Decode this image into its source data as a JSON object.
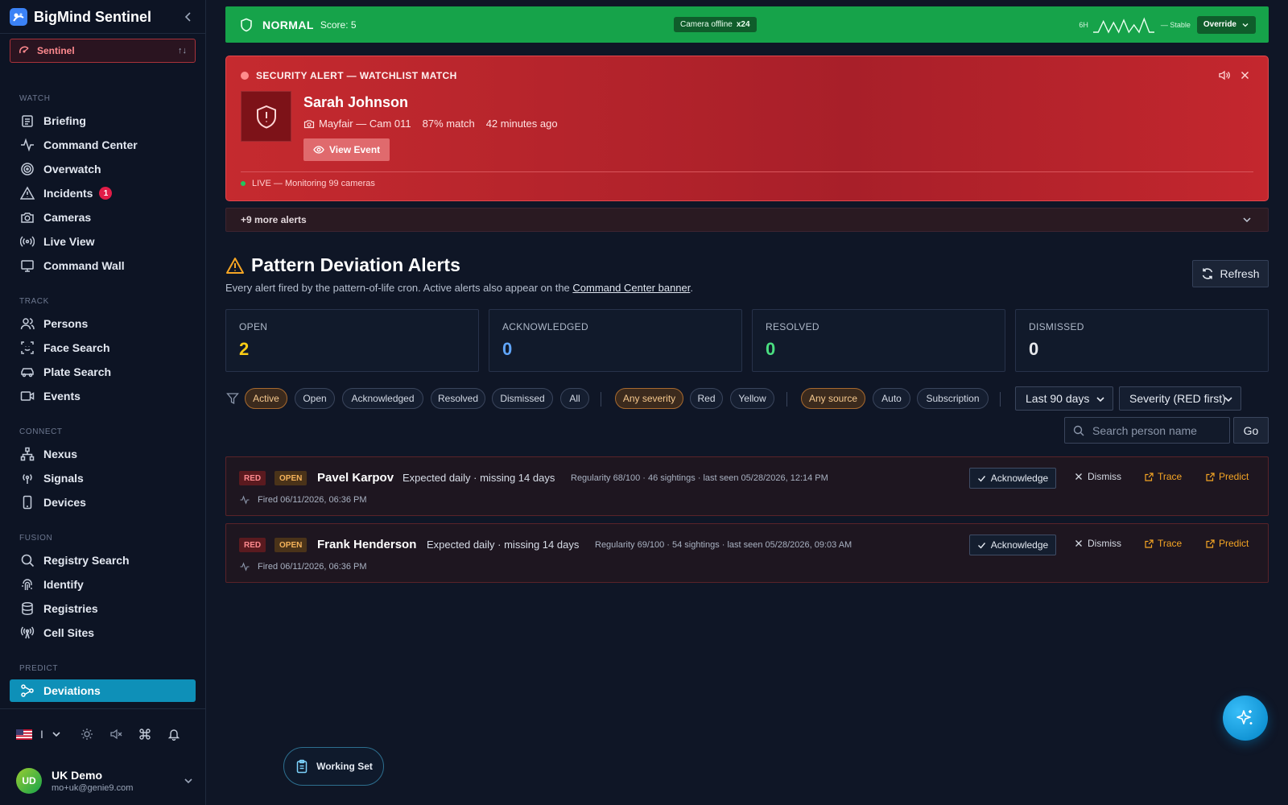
{
  "app": {
    "title": "BigMind Sentinel"
  },
  "workspace": {
    "label": "Sentinel"
  },
  "sidebar": {
    "sections": {
      "watch": "WATCH",
      "track": "TRACK",
      "connect": "CONNECT",
      "fusion": "FUSION",
      "predict": "PREDICT"
    },
    "items": {
      "briefing": "Briefing",
      "command_center": "Command Center",
      "overwatch": "Overwatch",
      "incidents": "Incidents",
      "incidents_badge": "1",
      "cameras": "Cameras",
      "live_view": "Live View",
      "command_wall": "Command Wall",
      "persons": "Persons",
      "face_search": "Face Search",
      "plate_search": "Plate Search",
      "events": "Events",
      "nexus": "Nexus",
      "signals": "Signals",
      "devices": "Devices",
      "registry_search": "Registry Search",
      "identify": "Identify",
      "registries": "Registries",
      "cell_sites": "Cell Sites",
      "deviations": "Deviations"
    },
    "tools": {
      "lang_sep": "I"
    },
    "user": {
      "initials": "UD",
      "name": "UK Demo",
      "email": "mo+uk@genie9.com"
    }
  },
  "status": {
    "level": "NORMAL",
    "score": "Score: 5",
    "camera_offline": "Camera offline",
    "camera_offline_count": "x24",
    "window": "6H",
    "trend": "— Stable",
    "override": "Override",
    "sparkline": [
      12,
      12,
      3,
      12,
      4,
      12,
      2,
      12,
      6,
      12,
      1,
      12,
      12
    ],
    "color": "#16a34a"
  },
  "security_alert": {
    "title": "SECURITY ALERT — WATCHLIST MATCH",
    "person": "Sarah Johnson",
    "location": "Mayfair — Cam 011",
    "match": "87% match",
    "time": "42 minutes ago",
    "view_button": "View Event",
    "live": "LIVE — Monitoring 99 cameras",
    "color": "#c52a2f"
  },
  "more_alerts": "+9 more alerts",
  "page": {
    "title": "Pattern Deviation Alerts",
    "subtitle": "Every alert fired by the pattern-of-life cron. Active alerts also appear on the",
    "subtitle_link": "Command Center banner",
    "subtitle_end": ".",
    "refresh": "Refresh"
  },
  "stats": [
    {
      "label": "OPEN",
      "value": "2",
      "color": "#facc15"
    },
    {
      "label": "ACKNOWLEDGED",
      "value": "0",
      "color": "#60a5fa"
    },
    {
      "label": "RESOLVED",
      "value": "0",
      "color": "#4ade80"
    },
    {
      "label": "DISMISSED",
      "value": "0",
      "color": "#e5e7eb"
    }
  ],
  "filters": {
    "status": [
      "Active",
      "Open",
      "Acknowledged",
      "Resolved",
      "Dismissed",
      "All"
    ],
    "status_selected": "Active",
    "severity": [
      "Any severity",
      "Red",
      "Yellow"
    ],
    "severity_selected": "Any severity",
    "source": [
      "Any source",
      "Auto",
      "Subscription"
    ],
    "source_selected": "Any source",
    "range": "Last 90 days",
    "sort": "Severity (RED first)",
    "search_placeholder": "Search person name",
    "go": "Go"
  },
  "alerts": [
    {
      "severity": "RED",
      "status": "OPEN",
      "name": "Pavel Karpov",
      "description": "Expected daily · missing 14 days",
      "meta": "Regularity 68/100 · 46 sightings · last seen 05/28/2026, 12:14 PM",
      "fired": "Fired 06/11/2026, 06:36 PM",
      "ack": "Acknowledge",
      "dismiss": "Dismiss",
      "trace": "Trace",
      "predict": "Predict"
    },
    {
      "severity": "RED",
      "status": "OPEN",
      "name": "Frank Henderson",
      "description": "Expected daily · missing 14 days",
      "meta": "Regularity 69/100 · 54 sightings · last seen 05/28/2026, 09:03 AM",
      "fired": "Fired 06/11/2026, 06:36 PM",
      "ack": "Acknowledge",
      "dismiss": "Dismiss",
      "trace": "Trace",
      "predict": "Predict"
    }
  ],
  "working_set": "Working Set"
}
